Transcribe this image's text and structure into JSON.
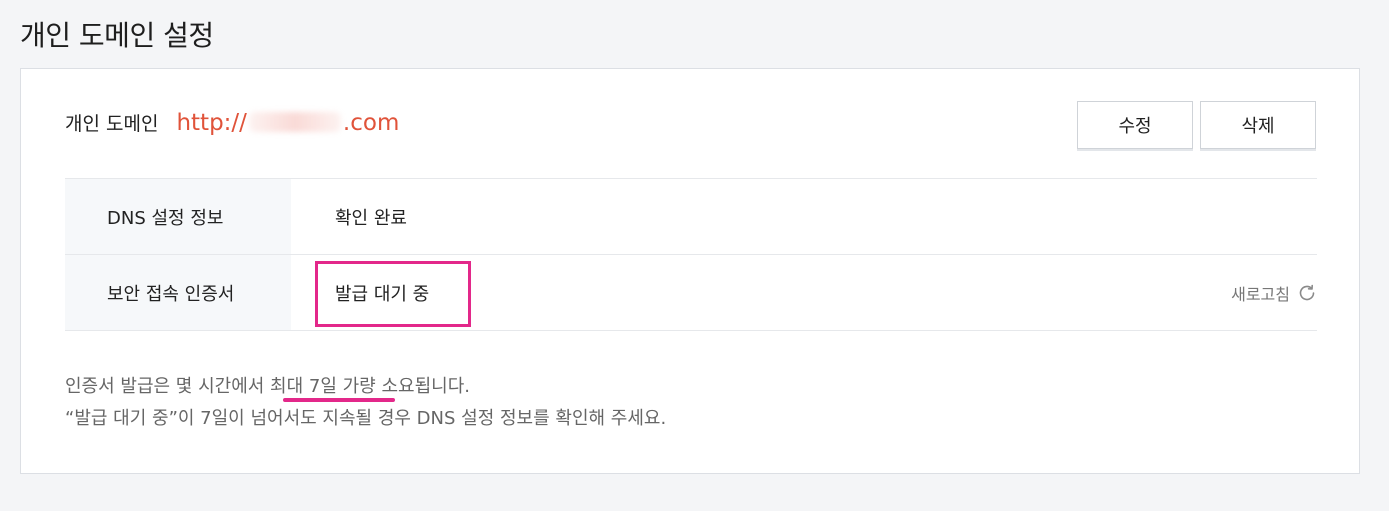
{
  "page": {
    "title": "개인 도메인 설정"
  },
  "domain": {
    "label": "개인 도메인",
    "url_prefix": "http://",
    "url_suffix": ".com"
  },
  "buttons": {
    "edit": "수정",
    "delete": "삭제"
  },
  "table": {
    "rows": [
      {
        "label": "DNS 설정 정보",
        "value": "확인 완료"
      },
      {
        "label": "보안 접속 인증서",
        "value": "발급 대기 중"
      }
    ],
    "refresh_label": "새로고침"
  },
  "notes": {
    "line1": "인증서 발급은 몇 시간에서 최대 7일 가량 소요됩니다.",
    "line2": "“발급 대기 중”이 7일이 넘어서도 지속될 경우 DNS 설정 정보를 확인해 주세요."
  },
  "colors": {
    "url": "#e0533a",
    "highlight": "#e3288a"
  },
  "icons": {
    "refresh": "refresh-icon"
  }
}
